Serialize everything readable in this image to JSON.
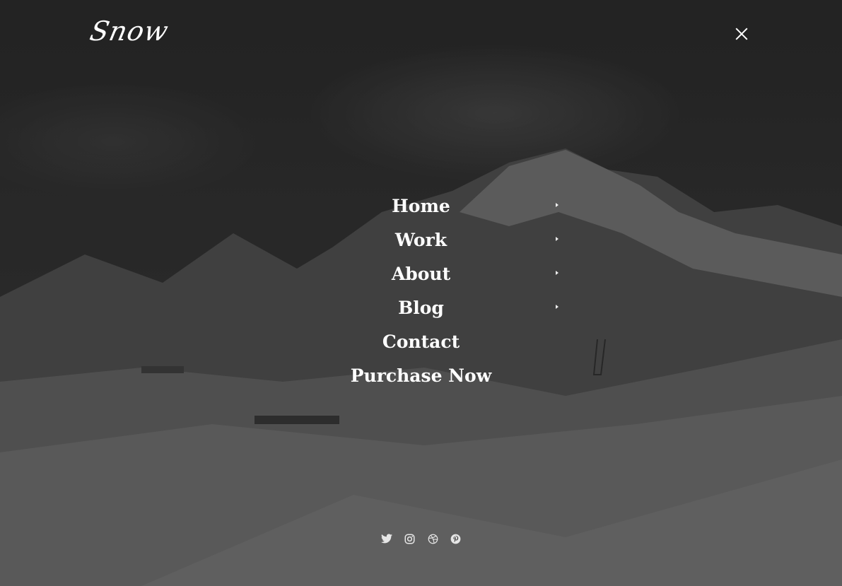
{
  "brand": {
    "logo_text": "Snow"
  },
  "header": {
    "close_icon": "close-icon"
  },
  "menu": {
    "items": [
      {
        "label": "Home",
        "has_submenu": true
      },
      {
        "label": "Work",
        "has_submenu": true
      },
      {
        "label": "About",
        "has_submenu": true
      },
      {
        "label": "Blog",
        "has_submenu": true
      },
      {
        "label": "Contact",
        "has_submenu": false
      },
      {
        "label": "Purchase Now",
        "has_submenu": false
      }
    ],
    "submenu_icon": "chevron-right-icon"
  },
  "social": {
    "icons": [
      "twitter-icon",
      "instagram-icon",
      "dribbble-icon",
      "pinterest-icon"
    ]
  },
  "colors": {
    "text": "#ffffff",
    "background": "#2a2a2a",
    "icon": "#e6e6e6"
  }
}
